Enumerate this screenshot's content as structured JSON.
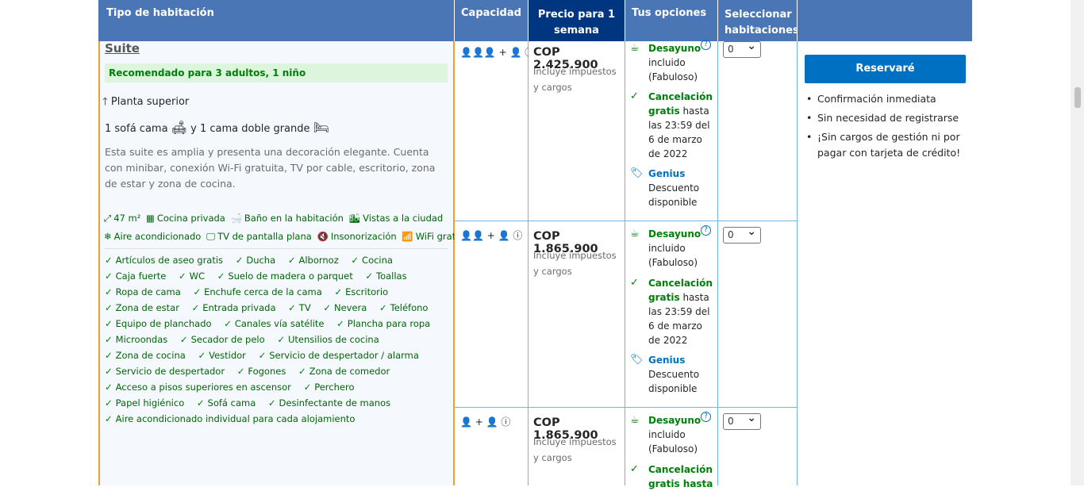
{
  "headers": {
    "room_type": "Tipo de habitación",
    "capacity": "Capacidad",
    "price": "Precio para 1 semana",
    "options": "Tus opciones",
    "select": "Seleccionar habitaciones"
  },
  "room": {
    "title": "Suite",
    "recommendation": "Recomendado para 3 adultos, 1 niño",
    "floor": "Planta superior",
    "beds": {
      "sofa": "1 sofá cama",
      "connector": "y 1 cama doble grande"
    },
    "description": "Esta suite es amplia y presenta una decoración elegante. Cuenta con minibar, conexión Wi-Fi gratuita, TV por cable, escritorio, zona de estar y zona de cocina.",
    "facilities_row1": [
      "47 m²",
      "Cocina privada",
      "Baño en la habitación",
      "Vistas a la ciudad"
    ],
    "facilities_row2": [
      "Aire acondicionado",
      "TV de pantalla plana",
      "Insonorización",
      "WiFi gratis"
    ],
    "amenities": [
      "Artículos de aseo gratis",
      "Ducha",
      "Albornoz",
      "Cocina",
      "Caja fuerte",
      "WC",
      "Suelo de madera o parquet",
      "Toallas",
      "Ropa de cama",
      "Enchufe cerca de la cama",
      "Escritorio",
      "Zona de estar",
      "Entrada privada",
      "TV",
      "Nevera",
      "Teléfono",
      "Equipo de planchado",
      "Canales vía satélite",
      "Plancha para ropa",
      "Microondas",
      "Secador de pelo",
      "Utensilios de cocina",
      "Zona de cocina",
      "Vestidor",
      "Servicio de despertador / alarma",
      "Servicio de despertador",
      "Fogones",
      "Zona de comedor",
      "Acceso a pisos superiores en ascensor",
      "Perchero",
      "Papel higiénico",
      "Sofá cama",
      "Desinfectante de manos",
      "Aire acondicionado individual para cada alojamiento"
    ]
  },
  "rates": [
    {
      "capacity": "3 adults + 1 child",
      "price": "COP 2.425.900",
      "price_note": "Incluye impuestos y cargos",
      "breakfast_title": "Desayuno",
      "breakfast_detail": "incluido (Fabuloso)",
      "cancel_title": "Cancelación gratis",
      "cancel_detail": "hasta las 23:59 del 6 de marzo de 2022",
      "genius_title": "Genius",
      "genius_detail": "Descuento disponible",
      "selected": "0"
    },
    {
      "capacity": "2 adults + 1 child",
      "price": "COP 1.865.900",
      "price_note": "Incluye impuestos y cargos",
      "breakfast_title": "Desayuno",
      "breakfast_detail": "incluido (Fabuloso)",
      "cancel_title": "Cancelación gratis",
      "cancel_detail": "hasta las 23:59 del 6 de marzo de 2022",
      "genius_title": "Genius",
      "genius_detail": "Descuento disponible",
      "selected": "0"
    },
    {
      "capacity": "1 adult + 1 child",
      "price": "COP 1.865.900",
      "price_note": "Incluye impuestos y cargos",
      "breakfast_title": "Desayuno",
      "breakfast_detail": "incluido (Fabuloso)",
      "cancel_title": "Cancelación",
      "cancel_detail": "gratis hasta",
      "selected": "0"
    }
  ],
  "reserve": {
    "button": "Reservaré",
    "benefits": [
      "Confirmación inmediata",
      "Sin necesidad de registrarse",
      "¡Sin cargos de gestión ni por pagar con tarjeta de crédito!"
    ]
  },
  "colors": {
    "header": "#4b76b5",
    "header_active": "#003580",
    "accent_green": "#008009",
    "button": "#0071c2",
    "border": "#6ab4e6",
    "highlight": "#f0a030"
  }
}
